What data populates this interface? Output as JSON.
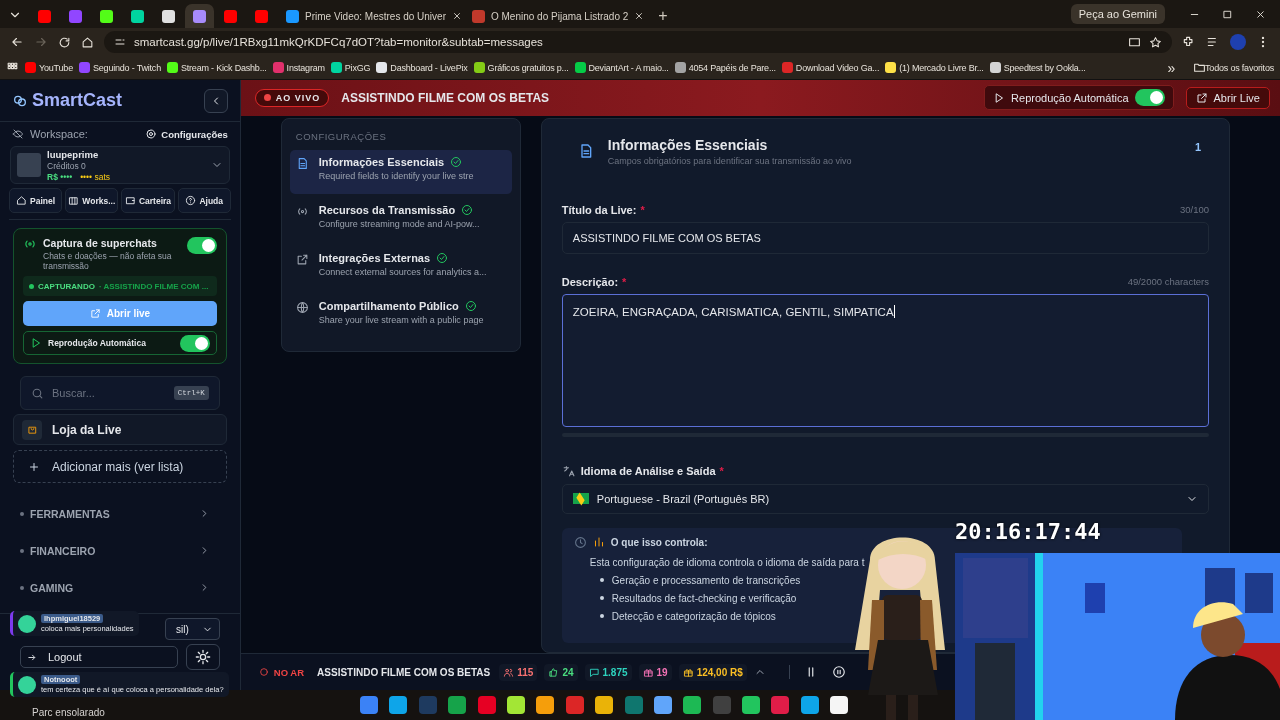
{
  "browser": {
    "tabs": [
      {
        "color": "#ff0000",
        "selected": false
      },
      {
        "color": "#9146ff",
        "selected": false
      },
      {
        "color": "#53fc18",
        "selected": false
      },
      {
        "color": "#00d4a0",
        "selected": false
      },
      {
        "color": "#e0e0e0",
        "selected": false
      },
      {
        "color": "#a78bfa",
        "selected": true
      },
      {
        "color": "#ff0000",
        "selected": false
      },
      {
        "color": "#ff0000",
        "selected": false
      },
      {
        "label": "Prime Video: Mestres do Univer",
        "color": "#1a98ff",
        "selected": false
      },
      {
        "label": "O Menino do Pijama Listrado 2",
        "color": "#c0392b",
        "selected": false
      }
    ],
    "new_tab": "+",
    "gemini_button": "Peça ao Gemini",
    "address": "smartcast.gg/p/live/1RBxg11mkQrKDFCq7dOT?tab=monitor&subtab=messages",
    "bookmarks": [
      {
        "label": "YouTube",
        "color": "#ff0000"
      },
      {
        "label": "Seguindo - Twitch",
        "color": "#9146ff"
      },
      {
        "label": "Stream - Kick Dashb...",
        "color": "#53fc18"
      },
      {
        "label": "Instagram",
        "color": "#e1306c"
      },
      {
        "label": "PixGG",
        "color": "#00d4a0"
      },
      {
        "label": "Dashboard - LivePix",
        "color": "#e5e7eb"
      },
      {
        "label": "Gráficos gratuitos p...",
        "color": "#84cc16"
      },
      {
        "label": "DeviantArt - A maio...",
        "color": "#05cc47"
      },
      {
        "label": "4054 Papéis de Pare...",
        "color": "#a3a3a3"
      },
      {
        "label": "Download Video Ga...",
        "color": "#dc2626"
      },
      {
        "label": "(1) Mercado Livre Br...",
        "color": "#fde047"
      },
      {
        "label": "Speedtest by Ookla...",
        "color": "#d4d4d4"
      }
    ],
    "more_bookmarks": "»",
    "all_bookmarks": "Todos os favoritos"
  },
  "sidebar": {
    "logo": "SmartCast",
    "workspace_label": "Workspace:",
    "settings_link": "Configurações",
    "account": {
      "name": "luupeprime",
      "credits": "Créditos 0",
      "balance": "R$ ••••",
      "sats": "•••• sats"
    },
    "nav": [
      "Painel",
      "Works...",
      "Carteira",
      "Ajuda"
    ],
    "superchat": {
      "title": "Captura de superchats",
      "subtitle": "Chats e doações — não afeta sua transmissão",
      "on": true,
      "status": "CAPTURANDO",
      "live_title": "· ASSISTINDO FILME COM ...",
      "open_button": "Abrir live",
      "autoplay_label": "Reprodução Automática",
      "autoplay_on": true
    },
    "search": {
      "placeholder": "Buscar...",
      "shortcut": "Ctrl+K"
    },
    "store": "Loja da Live",
    "add_more": "Adicionar mais (ver lista)",
    "sections": [
      {
        "label": "FERRAMENTAS",
        "expanded": false
      },
      {
        "label": "FINANCEIRO",
        "expanded": false
      },
      {
        "label": "GAMING",
        "expanded": false
      }
    ],
    "language_select": "sil)",
    "logout": "Logout"
  },
  "header": {
    "live_badge": "AO VIVO",
    "title": "ASSISTINDO FILME COM OS BETAS",
    "autoplay_label": "Reprodução Automática",
    "autoplay_on": true,
    "open_button": "Abrir Live"
  },
  "config_nav": {
    "heading": "CONFIGURAÇÕES",
    "items": [
      {
        "title": "Informações Essenciais",
        "description": "Required fields to identify your live stre",
        "selected": true,
        "done": true
      },
      {
        "title": "Recursos da Transmissão",
        "description": "Configure streaming mode and AI-pow...",
        "selected": false,
        "done": true
      },
      {
        "title": "Integrações Externas",
        "description": "Connect external sources for analytics a...",
        "selected": false,
        "done": true
      },
      {
        "title": "Compartilhamento Público",
        "description": "Share your live stream with a public page",
        "selected": false,
        "done": true
      }
    ]
  },
  "form": {
    "title": "Informações Essenciais",
    "subtitle": "Campos obrigatórios para identificar sua transmissão ao vivo",
    "step": "1",
    "fields": [
      {
        "kind": "input",
        "label": "Título da Live:",
        "required_mark": "*",
        "counter": "30/100",
        "value": "ASSISTINDO FILME COM OS BETAS",
        "focused": false
      },
      {
        "kind": "textarea",
        "label": "Descrição:",
        "required_mark": "*",
        "counter": "49/2000 characters",
        "value": "ZOEIRA, ENGRAÇADA, CARISMATICA, GENTIL, SIMPATICA",
        "focused": true
      }
    ],
    "language": {
      "label": "Idioma de Análise e Saída",
      "required_mark": "*",
      "value": "Portuguese - Brazil (Português BR)"
    },
    "info": {
      "heading": "O que isso controla:",
      "text": "Esta configuração de idioma controla o idioma de saída para t",
      "bullets": [
        "Geração e processamento de transcrições",
        "Resultados de fact-checking e verificação",
        "Detecção e categorização de tópicos"
      ]
    }
  },
  "stream_bar": {
    "status": "NO AR",
    "title": "ASSISTINDO FILME COM OS BETAS",
    "stats": [
      {
        "value": "115",
        "color": "#f87171"
      },
      {
        "value": "24",
        "color": "#4ade80"
      },
      {
        "value": "1.875",
        "color": "#2dd4bf"
      },
      {
        "value": "19",
        "color": "#f472b6"
      },
      {
        "value": "124,00 R$",
        "color": "#fbbf24"
      }
    ]
  },
  "overlay": {
    "timer": "20:16:17:44",
    "chats": [
      {
        "user": "lhpmiguel18529",
        "message": "coloca mais personalidades",
        "color": "#7c3aed"
      },
      {
        "user": "Notnooot",
        "message": "tem certeza que é aí que coloca a personalidade dela?",
        "color": "#22c55e"
      }
    ]
  },
  "taskbar": {
    "weather": "Parc ensolarado",
    "apps": [
      {
        "color": "#3b82f6"
      },
      {
        "color": "#0ea5e9"
      },
      {
        "color": "#1e3a5f"
      },
      {
        "color": "#16a34a"
      },
      {
        "color": "#e60023"
      },
      {
        "color": "#a3e635"
      },
      {
        "color": "#f59e0b"
      },
      {
        "color": "#dc2626"
      },
      {
        "color": "#eab308"
      },
      {
        "color": "#0f766e"
      },
      {
        "color": "#60a5fa"
      },
      {
        "color": "#1db954"
      },
      {
        "color": "#404040"
      },
      {
        "color": "#22c55e"
      },
      {
        "color": "#e11d48"
      },
      {
        "color": "#0ea5e9"
      },
      {
        "color": "#f5f5f5"
      }
    ]
  }
}
